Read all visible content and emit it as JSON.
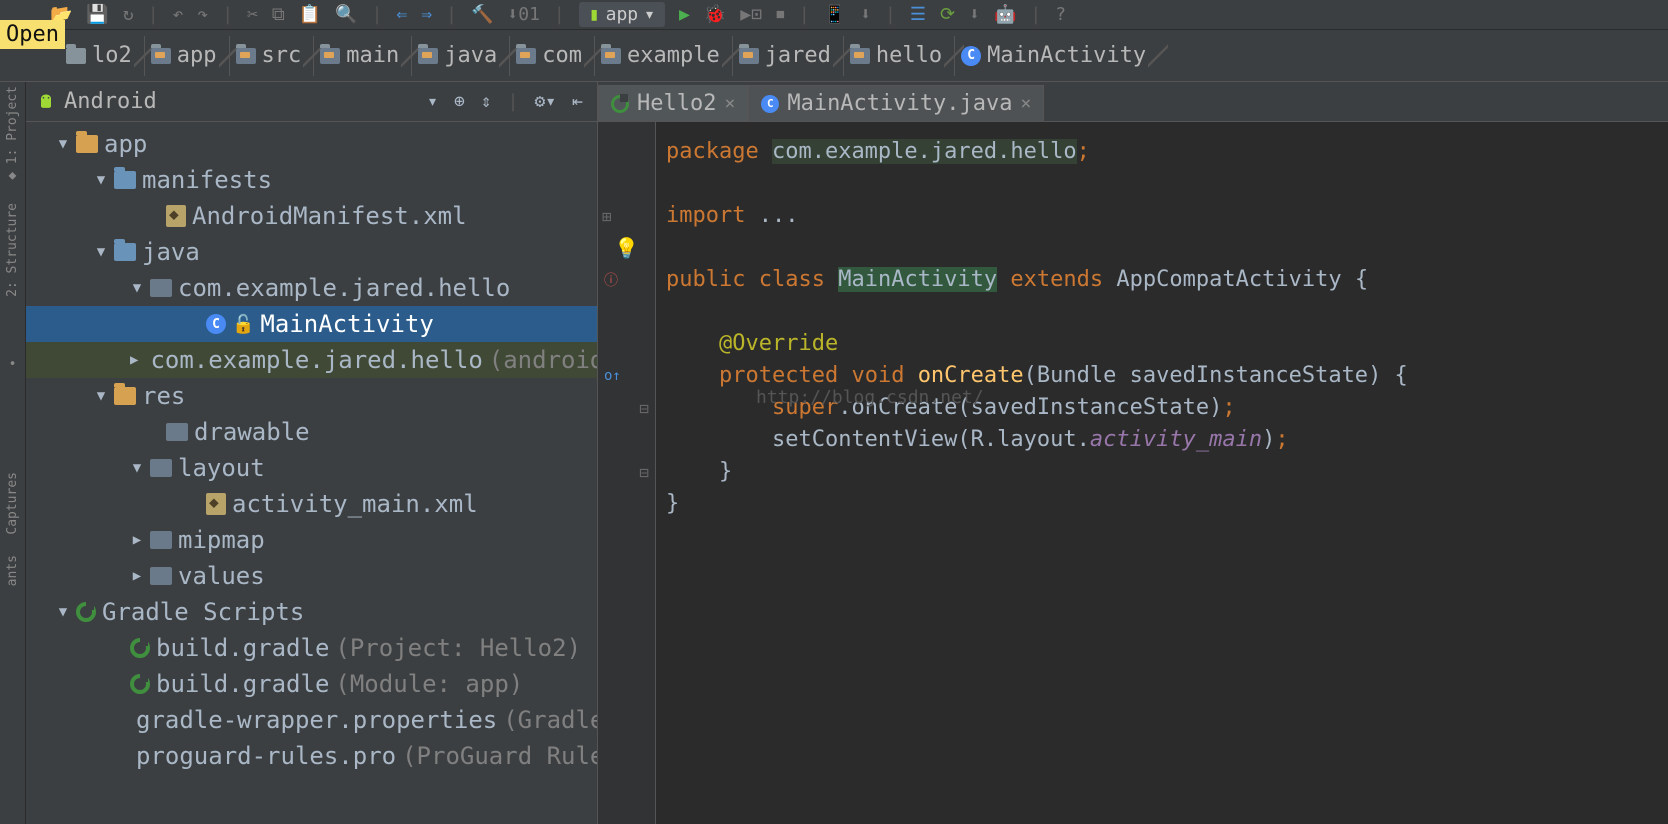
{
  "tooltip": {
    "open": "Open"
  },
  "breadcrumbs": [
    {
      "icon": "folder",
      "label": "lo2"
    },
    {
      "icon": "folder-o",
      "label": "app"
    },
    {
      "icon": "folder-o",
      "label": "src"
    },
    {
      "icon": "folder-o",
      "label": "main"
    },
    {
      "icon": "folder-o",
      "label": "java"
    },
    {
      "icon": "folder-o",
      "label": "com"
    },
    {
      "icon": "folder-o",
      "label": "example"
    },
    {
      "icon": "folder-o",
      "label": "jared"
    },
    {
      "icon": "folder-o",
      "label": "hello"
    },
    {
      "icon": "class",
      "label": "MainActivity"
    }
  ],
  "run_config": "app",
  "sidebar": {
    "title": "Android",
    "tree": {
      "app": "app",
      "manifests": "manifests",
      "manifest_file": "AndroidManifest.xml",
      "java": "java",
      "pkg1": "com.example.jared.hello",
      "main_activity": "MainActivity",
      "pkg2": "com.example.jared.hello",
      "pkg2_suffix": " (androidTest)",
      "res": "res",
      "drawable": "drawable",
      "layout": "layout",
      "layout_file": "activity_main.xml",
      "mipmap": "mipmap",
      "values": "values",
      "gradle_scripts": "Gradle Scripts",
      "build_gradle1": "build.gradle",
      "build_gradle1_suffix": " (Project: Hello2)",
      "build_gradle2": "build.gradle",
      "build_gradle2_suffix": " (Module: app)",
      "gradle_wrapper": "gradle-wrapper.properties",
      "gradle_wrapper_suffix": " (Gradle Version)",
      "proguard": "proguard-rules.pro",
      "proguard_suffix": " (ProGuard Rules)"
    }
  },
  "left_rail": {
    "project": "1: Project",
    "structure": "2: Structure",
    "captures": "Captures",
    "variants": "ants"
  },
  "tabs": [
    {
      "icon": "gradle",
      "label": "Hello2"
    },
    {
      "icon": "class",
      "label": "MainActivity.java"
    }
  ],
  "code": {
    "package_kw": "package",
    "package_name": "com.example.jared.hello",
    "import_kw": "import",
    "import_rest": "...",
    "public_kw": "public",
    "class_kw": "class",
    "class_name": "MainActivity",
    "extends_kw": "extends",
    "super_class": "AppCompatActivity",
    "annotation": "@Override",
    "protected_kw": "protected",
    "void_kw": "void",
    "method_name": "onCreate",
    "param_type": "Bundle",
    "param_name": "savedInstanceState",
    "super_kw": "super",
    "super_call": "onCreate",
    "super_arg": "savedInstanceState",
    "setcontent": "setContentView",
    "r_prefix": "R.layout.",
    "layout_ref": "activity_main",
    "watermark": "http://blog.csdn.net/"
  }
}
